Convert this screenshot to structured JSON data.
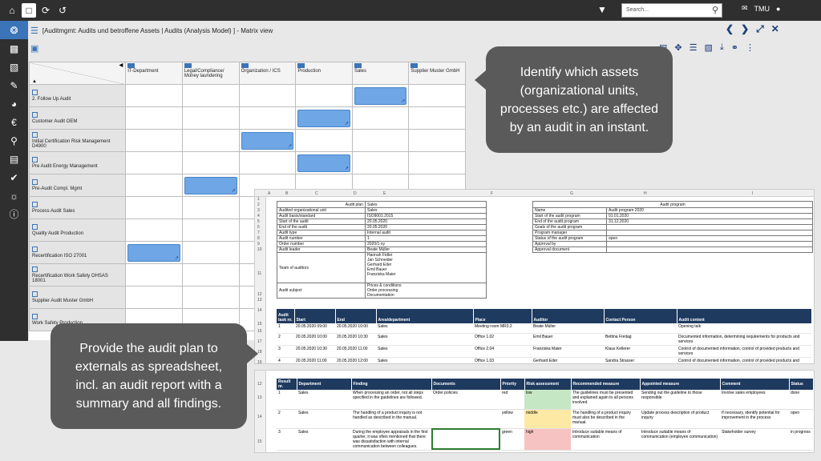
{
  "topbar": {
    "search_placeholder": "Search...",
    "user": "TMU"
  },
  "breadcrumb": {
    "text": "[Auditmgmt: Audits und betroffene Assets | Audits  (Analysis Model) ] - Matrix view"
  },
  "matrix": {
    "columns": [
      "IT-Department",
      "Legal/Compliance/ Money laundering",
      "Organization / ICS",
      "Production",
      "Sales",
      "Supplier Muster GmbH"
    ],
    "rows": [
      {
        "label": "2. Follow Up Audit",
        "hit": 4
      },
      {
        "label": "Customer Audit OEM",
        "hit": 3
      },
      {
        "label": "Initial Certification Risk Management D4900",
        "hit": 2
      },
      {
        "label": "Pre Audit Energy Management",
        "hit": 3
      },
      {
        "label": "Pre-Audit Compl. Mgmt",
        "hit": 1
      },
      {
        "label": "Process Audit Sales",
        "hit": -1
      },
      {
        "label": "Quality Audit Production",
        "hit": -1
      },
      {
        "label": "Recertification ISO 27001",
        "hit": 0
      },
      {
        "label": "Recertification Work Safety OHSAS 18001",
        "hit": -1
      },
      {
        "label": "Supplier Audit Muster GmbH",
        "hit": -1
      },
      {
        "label": "Work Safety Production",
        "hit": -1
      }
    ]
  },
  "callouts": {
    "top": "Identify which assets (organizational units, processes etc.) are affected by an audit in an instant.",
    "bottom": "Provide the audit plan to externals as spreadsheet, incl. an audit report with a summary and all findings."
  },
  "sheet1": {
    "col_letters": [
      "A",
      "B",
      "C",
      "D",
      "E",
      "F",
      "G",
      "H",
      "I"
    ],
    "row_numbers": [
      "1",
      "2",
      "3",
      "4",
      "5",
      "6",
      "7",
      "8",
      "9",
      "10",
      "11",
      "12",
      "13",
      "14",
      "15",
      "16",
      "17",
      "18",
      "19"
    ],
    "audit_plan_header": [
      "Audit plan",
      "Sales"
    ],
    "audit_plan": [
      [
        "Audited organizational unit",
        "Sales"
      ],
      [
        "Audit basis/standard",
        "ISO9001:2015"
      ],
      [
        "Start of the audit",
        "20.05.2020"
      ],
      [
        "End of the audit",
        "20.05.2020"
      ],
      [
        "Audit type",
        "Internal audit"
      ],
      [
        "Audit number",
        "1"
      ],
      [
        "Order number",
        "2020/1-xy"
      ],
      [
        "Audit leader",
        "Beate Müller"
      ]
    ],
    "team_label": "Team of auditors",
    "team": [
      "Hannah Fidler",
      "Jan Schneider",
      "Gerhard Eder",
      "Emil Bauer",
      "Franziska Maier"
    ],
    "subject_label": "Audit subject",
    "subject": [
      "Prices & conditions",
      "Order processing",
      "Documentation"
    ],
    "program_header": "Audit program",
    "program": [
      [
        "Name",
        "Audit program 2020"
      ],
      [
        "Start of the audit program",
        "01.01.2020"
      ],
      [
        "End of the audit program",
        "31.12.2020"
      ],
      [
        "Goals of the audit program",
        ""
      ],
      [
        "Program manager",
        ""
      ],
      [
        "Status of the audit program",
        "open"
      ],
      [
        "Approval by",
        ""
      ],
      [
        "Approval document",
        ""
      ]
    ],
    "task_headers": [
      "Audit task nr.",
      "Start",
      "End",
      "Area/department",
      "Place",
      "Auditor",
      "Contact Person",
      "Audit content"
    ],
    "tasks": [
      [
        "1",
        "20.05.2020 09:00",
        "20.05.2020 10:00",
        "Sales",
        "Meeting room MR3.2",
        "Beate Müller",
        "",
        "Opening talk"
      ],
      [
        "2",
        "20.05.2020 10:00",
        "20.05.2020 10:30",
        "Sales",
        "Office 1.02",
        "Emil Bauer",
        "Bettina Freitag",
        "Documented information, determining requirements for products and services"
      ],
      [
        "3",
        "20.05.2020 10:30",
        "20.05.2020 11:00",
        "Sales",
        "Office 2.04",
        "Franziska Maier",
        "Klaus Kellerer",
        "Control of documented information, control of provided products and services"
      ],
      [
        "4",
        "20.05.2020 11:00",
        "20.05.2020 12:00",
        "Sales",
        "Office 1.03",
        "Gerhard Eder",
        "Sandra Strasser",
        "Control of documented information, control of provided products and services"
      ]
    ]
  },
  "sheet2": {
    "row_numbers": [
      "12",
      "13",
      "14",
      "15"
    ],
    "headers": [
      "Result nr.",
      "Department",
      "Finding",
      "Documents",
      "Priority",
      "Risk assessment",
      "Recommended measure",
      "Appointed measure",
      "Comment",
      "Status"
    ],
    "rows": [
      [
        "1",
        "Sales",
        "When processing an order, not all steps specified in the guidelines are followed.",
        "Order policies",
        "red",
        "low",
        "The guidelines must be presented and explained again to all persons involved",
        "Sending out the guideline to those responsible",
        "Involve sales employees",
        "done"
      ],
      [
        "2",
        "Sales",
        "The handling of a product inquiry is not handled as described in the manual.",
        "",
        "yellow",
        "middle",
        "The handling of a product inquiry must also be described in the manual.",
        "Update process description of product inquiry",
        "If necessary, identify potential for improvement in the process",
        "open"
      ],
      [
        "3",
        "Sales",
        "During the employee appraisals in the first quarter, it was often mentioned that there was dissatisfaction with internal communication between colleagues.",
        "",
        "green",
        "high",
        "Introduce suitable means of communication",
        "Introduce suitable means of communication (employee communication)",
        "Stakeholder survey",
        "in progress"
      ]
    ]
  }
}
